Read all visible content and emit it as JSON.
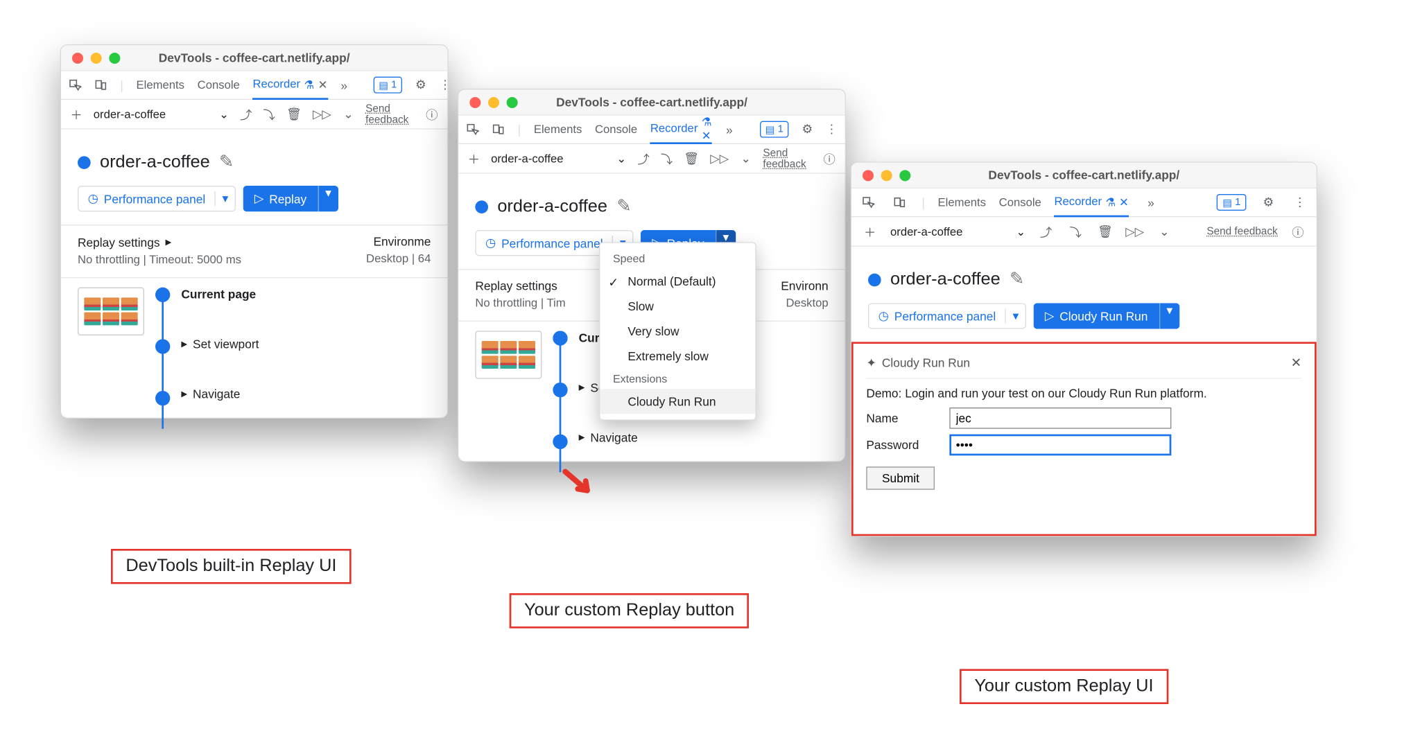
{
  "window_title": "DevTools - coffee-cart.netlify.app/",
  "tabs": {
    "elements": "Elements",
    "console": "Console",
    "recorder": "Recorder"
  },
  "issues_badge": "1",
  "recording_name": "order-a-coffee",
  "feedback": "Send feedback",
  "perf_panel": "Performance panel",
  "replay_label": "Replay",
  "custom_replay_label": "Cloudy Run Run",
  "replay_settings_title": "Replay settings",
  "replay_settings_detail": "No throttling | Timeout: 5000 ms",
  "replay_settings_detail_cut": "No throttling | Tim",
  "env_title_full": "Environment",
  "env_title_cut": "Environme",
  "env_title_cut2": "Environn",
  "env_detail": "Desktop | 64",
  "env_detail_short": "Desktop",
  "steps": {
    "current": "Current page",
    "viewport": "Set viewport",
    "navigate": "Navigate"
  },
  "speed_menu": {
    "header1": "Speed",
    "normal": "Normal (Default)",
    "slow": "Slow",
    "veryslow": "Very slow",
    "extslow": "Extremely slow",
    "header2": "Extensions",
    "ext1": "Cloudy Run Run"
  },
  "ext_panel": {
    "title": "Cloudy Run Run",
    "demo": "Demo: Login and run your test on our Cloudy Run Run platform.",
    "name_label": "Name",
    "name_value": "jec",
    "password_label": "Password",
    "password_value": "••••",
    "submit": "Submit"
  },
  "annotations": {
    "a1": "DevTools built-in Replay UI",
    "a2": "Your custom Replay button",
    "a3": "Your custom Replay UI"
  }
}
